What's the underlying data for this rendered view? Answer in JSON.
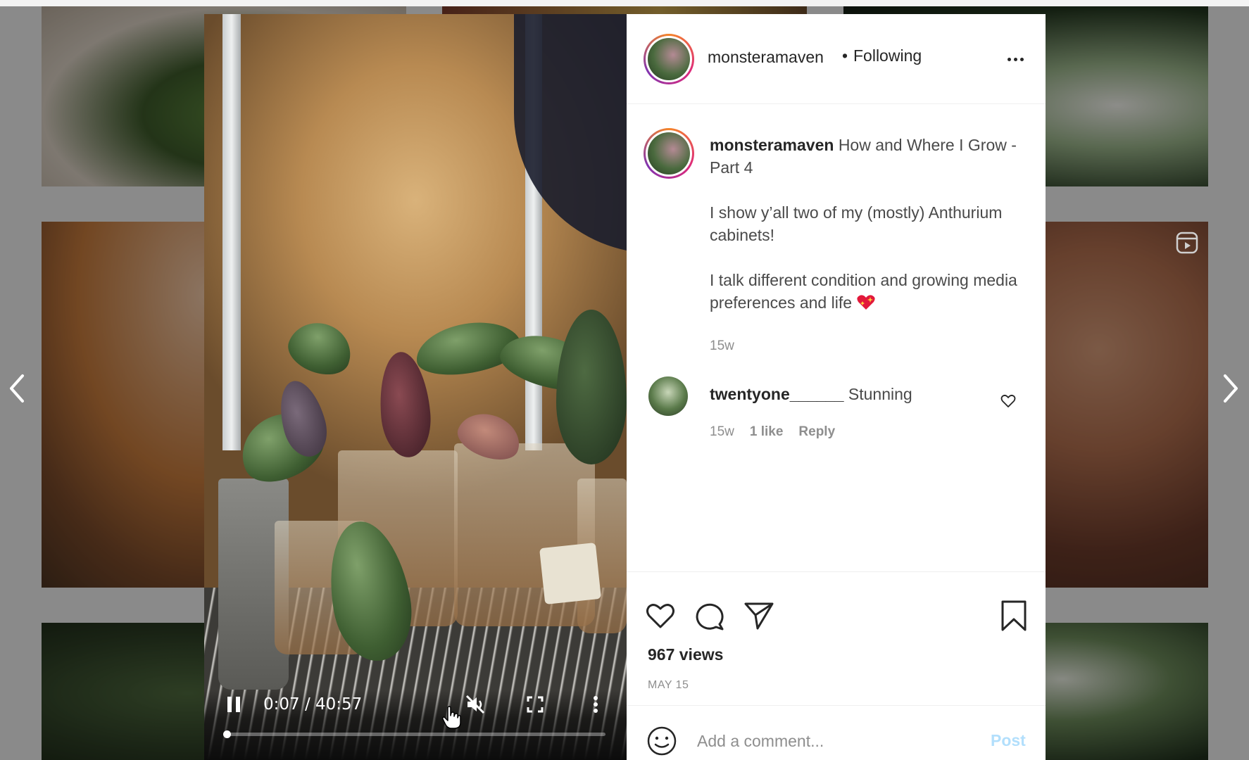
{
  "post": {
    "username": "monsteramaven",
    "follow_separator": "•",
    "follow_status": "Following",
    "caption_title": "How and Where I Grow - Part 4",
    "caption_line2": "I show y’all two of my (mostly) Anthurium cabinets!",
    "caption_line3": "I talk different condition and growing media preferences and life",
    "caption_emoji": "sparkling-heart-icon",
    "caption_age": "15w",
    "views": "967 views",
    "date": "MAY 15"
  },
  "comment": {
    "username": "twentyone______",
    "text": "Stunning",
    "age": "15w",
    "likes": "1 like",
    "reply_label": "Reply"
  },
  "video": {
    "time_display": "0:07 / 40:57",
    "progress": 0.003,
    "playing": true,
    "muted": true
  },
  "composer": {
    "placeholder": "Add a comment...",
    "post_label": "Post"
  },
  "colors": {
    "story_ring": [
      "#f58529",
      "#dd2a7b",
      "#8134af"
    ],
    "post_button_disabled": "#b2dffc",
    "secondary_text": "#8e8e8e"
  }
}
